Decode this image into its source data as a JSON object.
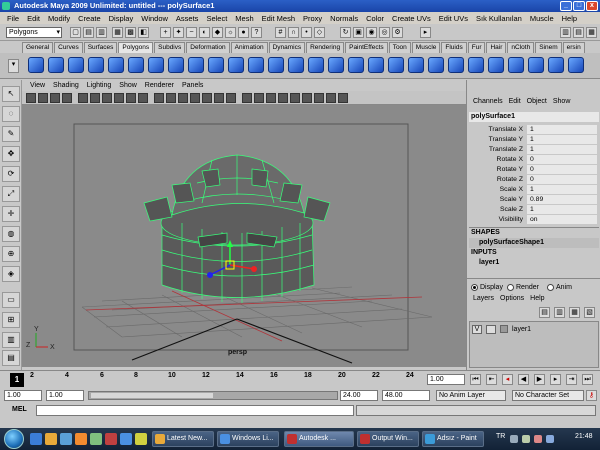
{
  "window": {
    "title": "Autodesk Maya 2009 Unlimited: untitled   ---   polySurface1",
    "controls": [
      "_",
      "□",
      "x"
    ]
  },
  "menubar": {
    "items": [
      "File",
      "Edit",
      "Modify",
      "Create",
      "Display",
      "Window",
      "Assets",
      "Select",
      "Mesh",
      "Edit Mesh",
      "Proxy",
      "Normals",
      "Color",
      "Create UVs",
      "Edit UVs",
      "Sık Kullanılan",
      "Muscle",
      "Help"
    ]
  },
  "status_line": {
    "mode": "Polygons"
  },
  "shelf": {
    "tabs": [
      "General",
      "Curves",
      "Surfaces",
      "Polygons",
      "Subdivs",
      "Deformation",
      "Animation",
      "Dynamics",
      "Rendering",
      "PaintEffects",
      "Toon",
      "Muscle",
      "Fluids",
      "Fur",
      "Hair",
      "nCloth",
      "Sinem",
      "ersin"
    ],
    "active_tab": "Polygons"
  },
  "panel_menu": {
    "items": [
      "View",
      "Shading",
      "Lighting",
      "Show",
      "Renderer",
      "Panels"
    ]
  },
  "viewport": {
    "camera_label": "persp",
    "axis_x": "X",
    "axis_y": "Y",
    "axis_z": "Z"
  },
  "channel_box": {
    "menu": [
      "Channels",
      "Edit",
      "Object",
      "Show"
    ],
    "object_name": "polySurface1",
    "attributes": [
      {
        "name": "Translate X",
        "value": "1"
      },
      {
        "name": "Translate Y",
        "value": "1"
      },
      {
        "name": "Translate Z",
        "value": "1"
      },
      {
        "name": "Rotate X",
        "value": "0"
      },
      {
        "name": "Rotate Y",
        "value": "0"
      },
      {
        "name": "Rotate Z",
        "value": "0"
      },
      {
        "name": "Scale X",
        "value": "1"
      },
      {
        "name": "Scale Y",
        "value": "0.89"
      },
      {
        "name": "Scale Z",
        "value": "1"
      },
      {
        "name": "Visibility",
        "value": "on"
      }
    ],
    "shapes_label": "SHAPES",
    "shape_name": "polySurfaceShape1",
    "inputs_label": "INPUTS",
    "input_name": "layer1"
  },
  "layer_editor": {
    "modes": [
      "Display",
      "Render",
      "Anim"
    ],
    "active_mode": "Display",
    "menu": [
      "Layers",
      "Options",
      "Help"
    ],
    "layers": [
      {
        "visible": "V",
        "name": "layer1"
      }
    ]
  },
  "time_slider": {
    "ticks": [
      "1",
      "2",
      "4",
      "6",
      "8",
      "10",
      "12",
      "14",
      "16",
      "18",
      "20",
      "22",
      "24"
    ],
    "current_frame": "1.00"
  },
  "range_slider": {
    "start": "1.00",
    "playback_start": "1.00",
    "playback_end": "24.00",
    "end": "48.00",
    "anim_layer": "No Anim Layer",
    "character_set": "No Character Set"
  },
  "command_line": {
    "label": "MEL"
  },
  "taskbar": {
    "buttons": [
      "Latest New...",
      "Windows Li...",
      "Autodesk ...",
      "Output Win...",
      "Adsız - Paint"
    ],
    "language": "TR",
    "clock": "21:48"
  },
  "colors": {
    "viewport_bg": "#8a8a8a",
    "wireframe": "#38ff7a",
    "mesh_fill": "#5a5a5a",
    "grid": "#5c5c5c",
    "grid_red": "#b0343a",
    "title_blue": "#1a45a8"
  }
}
